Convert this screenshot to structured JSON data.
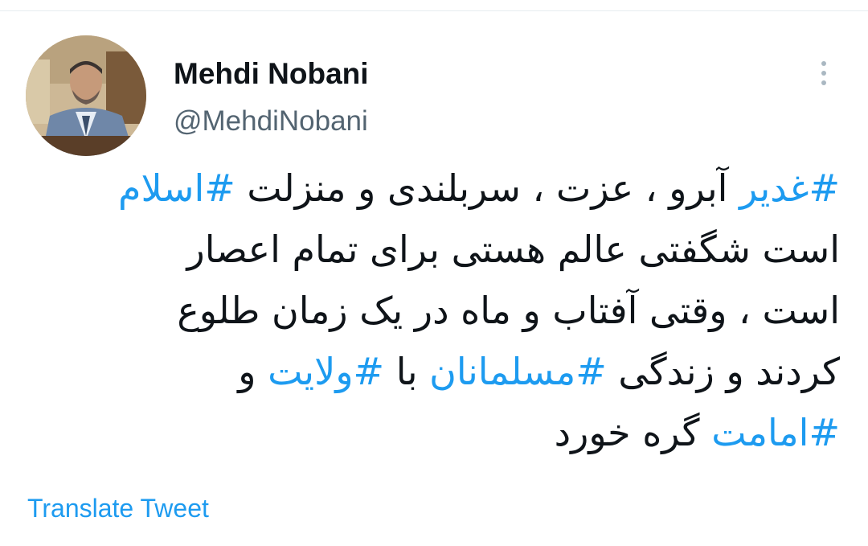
{
  "author": {
    "display_name": "Mehdi Nobani",
    "handle": "@MehdiNobani"
  },
  "more_icon": "vertical-ellipsis-icon",
  "tweet": {
    "lines": [
      [
        {
          "text": "#غدیر",
          "hashtag": true
        },
        {
          "text": " آبرو ، عزت ، سربلندی  و منزلت ",
          "hashtag": false
        },
        {
          "text": "#اسلام",
          "hashtag": true
        }
      ],
      [
        {
          "text": "است شگفتی عالم هستی برای تمام اعصار",
          "hashtag": false
        }
      ],
      [
        {
          "text": "است ، وقتی آفتاب و ماه در یک زمان طلوع",
          "hashtag": false
        }
      ],
      [
        {
          "text": "کردند و زندگی ",
          "hashtag": false
        },
        {
          "text": "#مسلمانان",
          "hashtag": true
        },
        {
          "text": "  با ",
          "hashtag": false
        },
        {
          "text": "#ولایت",
          "hashtag": true
        },
        {
          "text": " و",
          "hashtag": false
        }
      ],
      [
        {
          "text": "#امامت",
          "hashtag": true
        },
        {
          "text": " گره خورد",
          "hashtag": false
        }
      ]
    ]
  },
  "translate_label": "Translate Tweet",
  "colors": {
    "link": "#1d9bf0",
    "text": "#0f1419",
    "secondary": "#536471",
    "divider": "#e6ecf0"
  }
}
